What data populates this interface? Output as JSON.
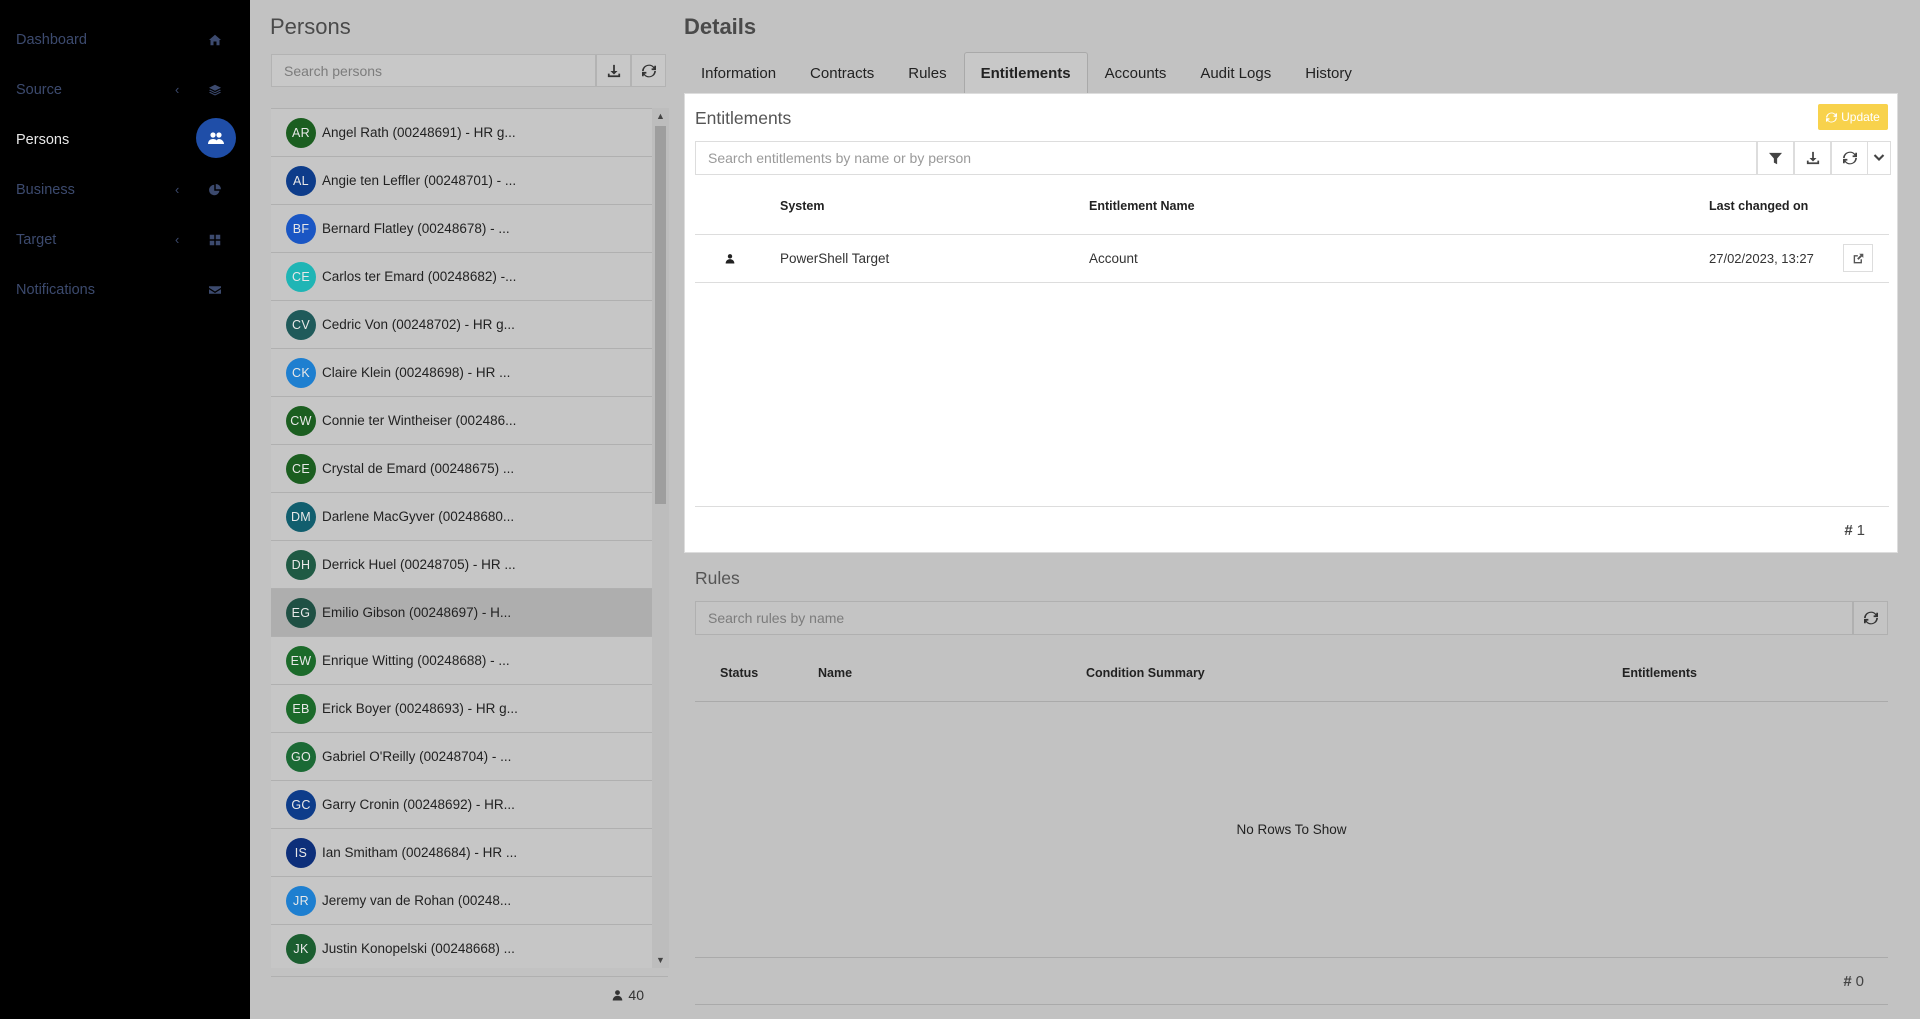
{
  "sidebar": {
    "items": [
      {
        "label": "Dashboard",
        "icon": "home-icon",
        "chevron": false,
        "active": false
      },
      {
        "label": "Source",
        "icon": "layers-icon",
        "chevron": true,
        "active": false
      },
      {
        "label": "Persons",
        "icon": "users-icon",
        "chevron": false,
        "active": true
      },
      {
        "label": "Business",
        "icon": "pie-chart-icon",
        "chevron": true,
        "active": false
      },
      {
        "label": "Target",
        "icon": "grid-icon",
        "chevron": true,
        "active": false
      },
      {
        "label": "Notifications",
        "icon": "envelope-icon",
        "chevron": false,
        "active": false
      }
    ],
    "chevron_glyph": "‹"
  },
  "persons": {
    "title": "Persons",
    "search_placeholder": "Search persons",
    "count": "40",
    "list": [
      {
        "initials": "AR",
        "name": "Angel Rath (00248691) - HR g...",
        "color": "#1b5e20"
      },
      {
        "initials": "AL",
        "name": "Angie ten Leffler (00248701) - ...",
        "color": "#0d3c8a"
      },
      {
        "initials": "BF",
        "name": "Bernard Flatley (00248678) - ...",
        "color": "#1a56c4"
      },
      {
        "initials": "CE",
        "name": "Carlos ter Emard (00248682) -...",
        "color": "#1fb5b5"
      },
      {
        "initials": "CV",
        "name": "Cedric Von (00248702) - HR g...",
        "color": "#1f5a5a"
      },
      {
        "initials": "CK",
        "name": "Claire Klein (00248698) - HR ...",
        "color": "#1e7fd0"
      },
      {
        "initials": "CW",
        "name": "Connie ter Wintheiser (002486...",
        "color": "#1b5e20"
      },
      {
        "initials": "CE",
        "name": "Crystal de Emard (00248675) ...",
        "color": "#1b5e20"
      },
      {
        "initials": "DM",
        "name": "Darlene MacGyver (00248680...",
        "color": "#115e6e"
      },
      {
        "initials": "DH",
        "name": "Derrick Huel (00248705) - HR ...",
        "color": "#1f5a44"
      },
      {
        "initials": "EG",
        "name": "Emilio Gibson (00248697) - H...",
        "color": "#1f5044",
        "selected": true
      },
      {
        "initials": "EW",
        "name": "Enrique Witting (00248688) - ...",
        "color": "#1b6a2a"
      },
      {
        "initials": "EB",
        "name": "Erick Boyer (00248693) - HR g...",
        "color": "#1b6a2a"
      },
      {
        "initials": "GO",
        "name": "Gabriel O'Reilly (00248704) - ...",
        "color": "#1b6a35"
      },
      {
        "initials": "GC",
        "name": "Garry Cronin (00248692) - HR...",
        "color": "#0d3c8a"
      },
      {
        "initials": "IS",
        "name": "Ian Smitham (00248684) - HR ...",
        "color": "#0d2f7a"
      },
      {
        "initials": "JR",
        "name": "Jeremy van de Rohan (00248...",
        "color": "#1e7fd0"
      },
      {
        "initials": "JK",
        "name": "Justin Konopelski (00248668) ...",
        "color": "#1b5e30"
      }
    ]
  },
  "details": {
    "title": "Details",
    "tabs": [
      "Information",
      "Contracts",
      "Rules",
      "Entitlements",
      "Accounts",
      "Audit Logs",
      "History"
    ],
    "active_tab": "Entitlements"
  },
  "entitlements": {
    "title": "Entitlements",
    "update_label": "Update",
    "search_placeholder": "Search entitlements by name or by person",
    "columns": {
      "system": "System",
      "name": "Entitlement Name",
      "changed": "Last changed on"
    },
    "rows": [
      {
        "system": "PowerShell Target",
        "name": "Account",
        "changed": "27/02/2023, 13:27"
      }
    ],
    "count": "1"
  },
  "rules": {
    "title": "Rules",
    "search_placeholder": "Search rules by name",
    "columns": {
      "status": "Status",
      "name": "Name",
      "condition": "Condition Summary",
      "entitlements": "Entitlements"
    },
    "empty_text": "No Rows To Show",
    "count": "0"
  },
  "colors": {
    "accent": "#1f4ea8",
    "update": "#f8d24c"
  }
}
